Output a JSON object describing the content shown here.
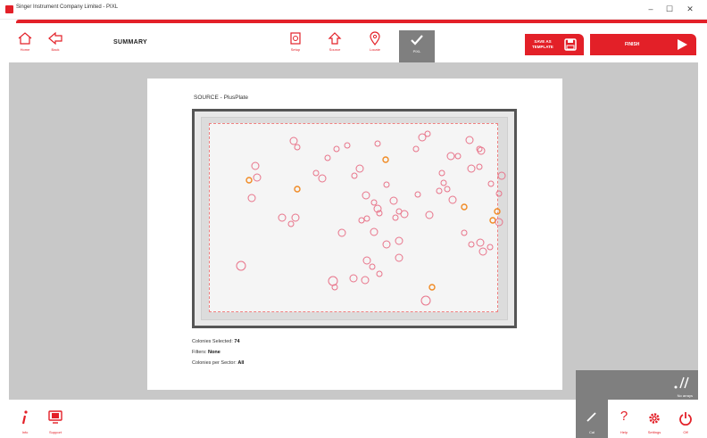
{
  "window": {
    "title": "Singer Instrument Company Limited - PIXL",
    "minimize": "–",
    "maximize": "☐",
    "close": "✕"
  },
  "toolbar": {
    "home_label": "Home",
    "back_label": "Back",
    "page_title": "SUMMARY",
    "steps": [
      {
        "label": "Setup"
      },
      {
        "label": "Source"
      },
      {
        "label": "Locate"
      },
      {
        "label": "PIXL"
      }
    ],
    "save_template_label_1": "SAVE AS",
    "save_template_label_2": "TEMPLATE",
    "finish_label": "FINISH"
  },
  "summary": {
    "source_title": "SOURCE - PlusPlate",
    "colonies_selected_label": "Colonies Selected:",
    "colonies_selected_value": "74",
    "filters_label": "Filters:",
    "filters_value": "None",
    "colonies_per_sector_label": "Colonies per Sector:",
    "colonies_per_sector_value": "All"
  },
  "bottom": {
    "info_label": "Info",
    "support_label": "Support",
    "no_arrays_label": "No arrays",
    "cal_label": "Cal",
    "help_label": "Help",
    "settings_label": "Settings",
    "off_label": "Off"
  },
  "colors": {
    "accent": "#e32028",
    "colony_selected": "#e8748a",
    "colony_orange": "#f08a24",
    "toolbar_active": "#7f7f7f",
    "workspace": "#c8c8c8"
  }
}
